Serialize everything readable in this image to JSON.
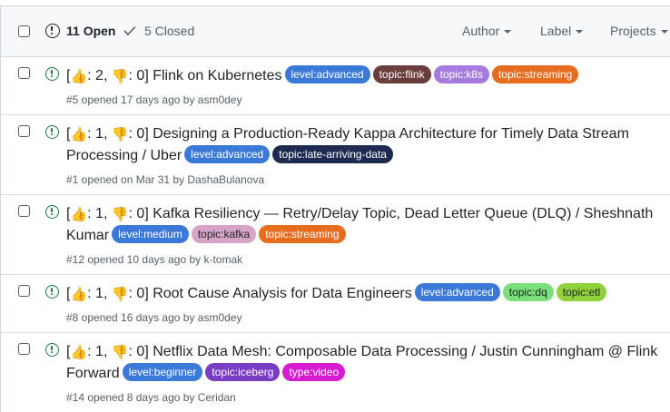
{
  "header": {
    "open_label": "11 Open",
    "closed_label": "5 Closed",
    "filters": {
      "author": "Author",
      "label": "Label",
      "projects": "Projects"
    }
  },
  "reaction_symbols": {
    "up": "👍",
    "down": "👎"
  },
  "label_colors": {
    "level:advanced": {
      "bg": "#3b79d8",
      "fg": "#ffffff"
    },
    "topic:flink": {
      "bg": "#6b3d3d",
      "fg": "#ffffff"
    },
    "topic:k8s": {
      "bg": "#a67be0",
      "fg": "#ffffff"
    },
    "topic:streaming": {
      "bg": "#e66d1f",
      "fg": "#ffffff"
    },
    "topic:late-arriving-data": {
      "bg": "#1e2a4f",
      "fg": "#ffffff"
    },
    "level:medium": {
      "bg": "#3b79d8",
      "fg": "#ffffff"
    },
    "topic:kafka": {
      "bg": "#d6a4c6",
      "fg": "#1f2328"
    },
    "topic:dq": {
      "bg": "#7be07b",
      "fg": "#1f2328"
    },
    "topic:etl": {
      "bg": "#8fd13b",
      "fg": "#1f2328"
    },
    "level:beginner": {
      "bg": "#3b79d8",
      "fg": "#ffffff"
    },
    "topic:iceberg": {
      "bg": "#7a3cc2",
      "fg": "#ffffff"
    },
    "type:video": {
      "bg": "#d61bd0",
      "fg": "#ffffff"
    }
  },
  "issues": [
    {
      "up": "2",
      "down": "0",
      "title": "Flink on Kubernetes",
      "labels": [
        "level:advanced",
        "topic:flink",
        "topic:k8s",
        "topic:streaming"
      ],
      "meta": "#5 opened 17 days ago by asm0dey"
    },
    {
      "up": "1",
      "down": "0",
      "title": "Designing a Production-Ready Kappa Architecture for Timely Data Stream Processing / Uber",
      "labels": [
        "level:advanced",
        "topic:late-arriving-data"
      ],
      "meta": "#1 opened on Mar 31 by DashaBulanova"
    },
    {
      "up": "1",
      "down": "0",
      "title": "Kafka Resiliency — Retry/Delay Topic, Dead Letter Queue (DLQ) / Sheshnath Kumar",
      "labels": [
        "level:medium",
        "topic:kafka",
        "topic:streaming"
      ],
      "meta": "#12 opened 10 days ago by k-tomak"
    },
    {
      "up": "1",
      "down": "0",
      "title": "Root Cause Analysis for Data Engineers",
      "labels": [
        "level:advanced",
        "topic:dq",
        "topic:etl"
      ],
      "meta": "#8 opened 16 days ago by asm0dey"
    },
    {
      "up": "1",
      "down": "0",
      "title": "Netflix Data Mesh: Composable Data Processing / Justin Cunningham @ Flink Forward",
      "labels": [
        "level:beginner",
        "topic:iceberg",
        "type:video"
      ],
      "meta": "#14 opened 8 days ago by Ceridan"
    }
  ]
}
